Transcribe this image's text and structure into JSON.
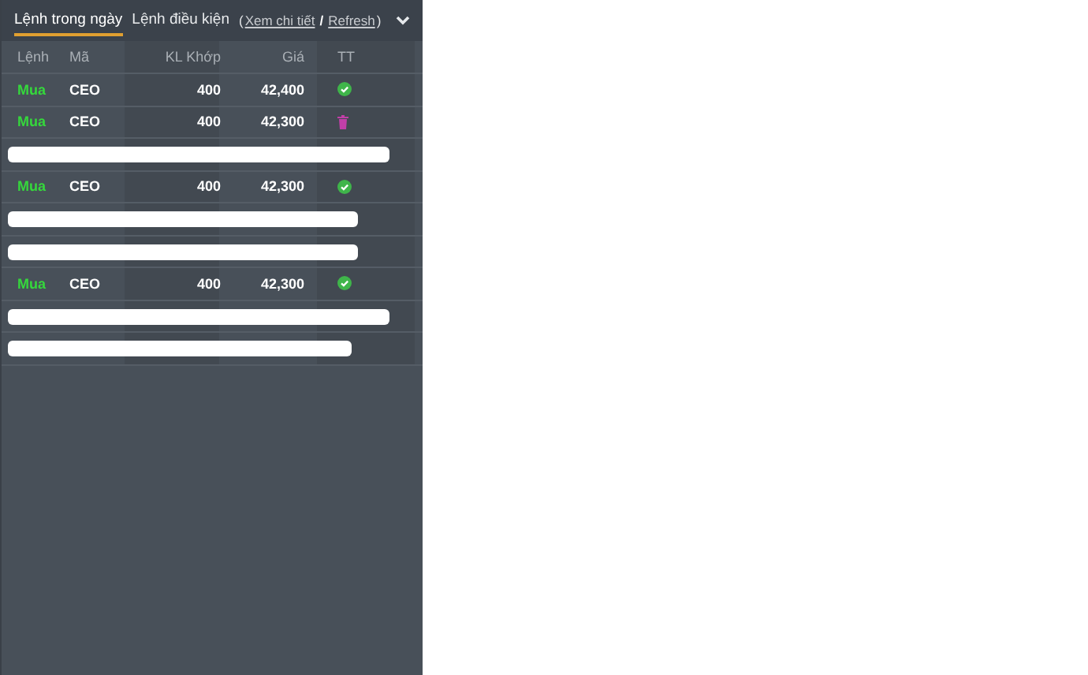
{
  "tabs": [
    {
      "label": "Lệnh trong ngày",
      "selected": true
    },
    {
      "label": "Lệnh điều kiện",
      "selected": false
    }
  ],
  "links": {
    "open": "(",
    "detail": "Xem chi tiết",
    "separator": "/",
    "refresh": "Refresh",
    "close": ")"
  },
  "table": {
    "columns": [
      "Lệnh",
      "Mã",
      "KL Khớp",
      "Giá",
      "TT"
    ],
    "rows": [
      {
        "kind": "order",
        "side": "Mua",
        "symbol": "CEO",
        "volume": "400",
        "price": "42,400",
        "cancelled": false
      },
      {
        "kind": "order",
        "side": "Mua",
        "symbol": "CEO",
        "volume": "400",
        "price": "42,300",
        "cancelled": true
      },
      {
        "kind": "redacted"
      },
      {
        "kind": "order",
        "side": "Mua",
        "symbol": "CEO",
        "volume": "400",
        "price": "42,300",
        "cancelled": false
      },
      {
        "kind": "redacted"
      },
      {
        "kind": "redacted"
      },
      {
        "kind": "order",
        "side": "Mua",
        "symbol": "CEO",
        "volume": "400",
        "price": "42,300",
        "cancelled": false
      },
      {
        "kind": "redacted"
      },
      {
        "kind": "redacted"
      }
    ]
  }
}
